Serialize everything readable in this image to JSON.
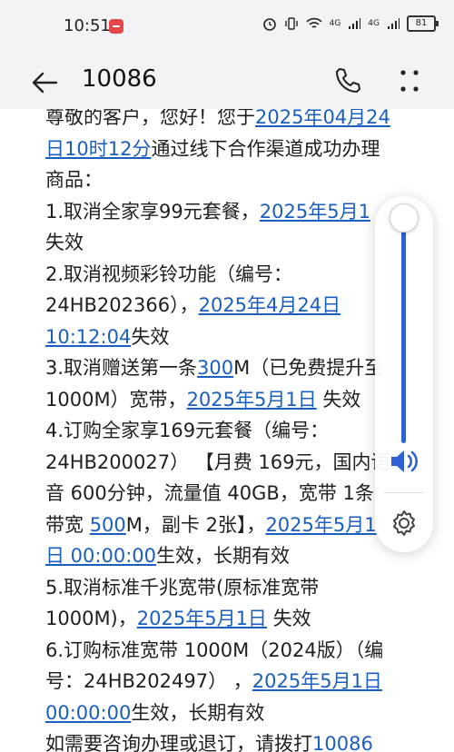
{
  "status_bar": {
    "time": "10:51",
    "signal_text_1": "4G",
    "signal_text_2": "4G",
    "battery": "81",
    "icons": [
      "alarm-icon",
      "vibrate-icon",
      "wifi-icon",
      "signal-icon",
      "battery-icon"
    ]
  },
  "header": {
    "title": "10086",
    "icons": [
      "back-arrow-icon",
      "phone-icon",
      "more-icon"
    ]
  },
  "message": {
    "lines": [
      [
        "尊敬的客户，您好！您于",
        "2025年04月24"
      ],
      [
        "日10时12分",
        "通过线下合作渠道成功办理"
      ],
      [
        "商品："
      ],
      [
        "1.取消全家享99元套餐，",
        "2025年5月1"
      ],
      [
        "失效"
      ],
      [
        "2.取消视频彩铃功能（编号："
      ],
      [
        "24HB202366），",
        "2025年4月24日"
      ],
      [
        "10:12:04",
        "失效"
      ],
      [
        "3.取消赠送第一条",
        "300",
        "M（已免费提升至"
      ],
      [
        "1000M）宽带，",
        "2025年5月1日",
        " 失效"
      ],
      [
        "4.订购全家享169元套餐（编号："
      ],
      [
        "24HB200027）  【月费 169元，国内语"
      ],
      [
        "音 600分钟，流量值 40GB，宽带 1条"
      ],
      [
        "带宽 ",
        "500",
        "M，副卡 2张】，",
        "2025年5月1"
      ],
      [
        "日 00:00:00",
        "生效，长期有效"
      ],
      [
        "5.取消标准千兆宽带(原标准宽带"
      ],
      [
        "1000M)，",
        "2025年5月1日",
        " 失效"
      ],
      [
        "6.订购标准宽带 1000M（2024版）（编"
      ],
      [
        "号：24HB202497）  ，",
        "2025年5月1日"
      ],
      [
        "00:00:00",
        "生效，长期有效"
      ],
      [
        "如需要咨询办理或退订，请拨打",
        "10086"
      ]
    ]
  },
  "volume_panel": {
    "level": 1.0,
    "icons": [
      "speaker-icon",
      "settings-gear-icon"
    ]
  },
  "colors": {
    "link": "#1a5fbf",
    "accent": "#2f60d6",
    "header_bg": "#f2f3f5"
  }
}
